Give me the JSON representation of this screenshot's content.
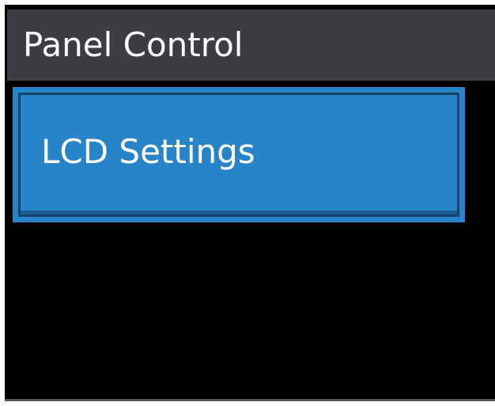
{
  "title_bar": {
    "title": "Panel Control"
  },
  "menu": {
    "items": [
      {
        "label": "LCD Settings",
        "selected": true
      }
    ]
  },
  "colors": {
    "screen_background": "#000000",
    "title_bar_background": "#3c3d42",
    "selected_item_background": "#2784c9",
    "selected_item_inner_border": "#17456a",
    "text": "#ffffff"
  }
}
